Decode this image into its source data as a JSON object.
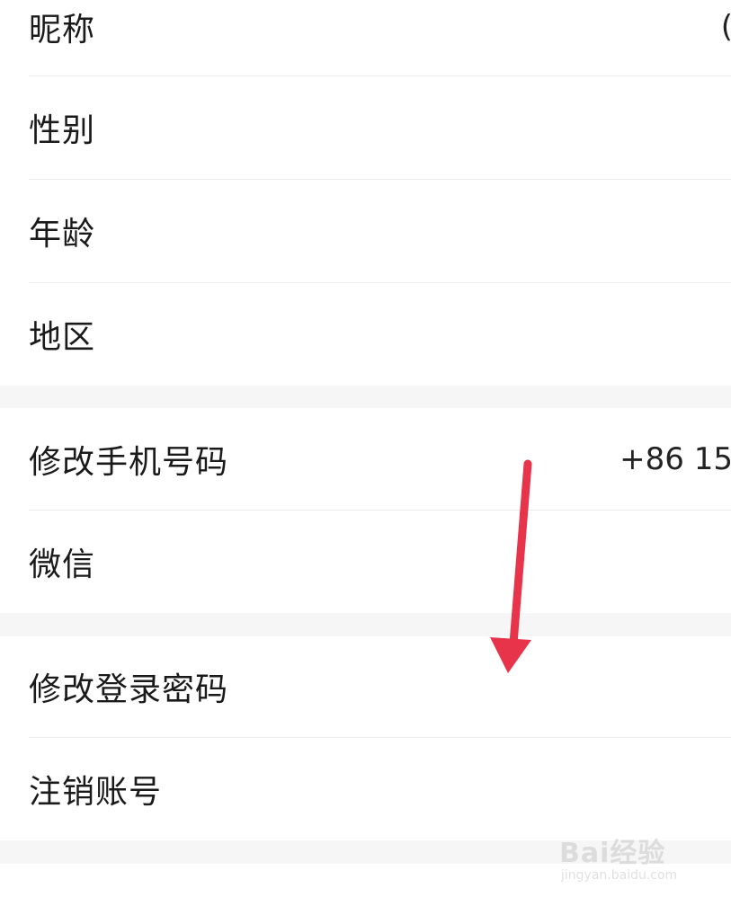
{
  "profile": {
    "nickname": {
      "label": "昵称",
      "value": "("
    },
    "gender": {
      "label": "性别"
    },
    "age": {
      "label": "年龄"
    },
    "region": {
      "label": "地区"
    }
  },
  "binding": {
    "phone": {
      "label": "修改手机号码",
      "value": "+86 15"
    },
    "wechat": {
      "label": "微信"
    }
  },
  "security": {
    "password": {
      "label": "修改登录密码"
    },
    "deactivate": {
      "label": "注销账号"
    }
  },
  "annotation": {
    "arrow_color": "#e8344a"
  },
  "watermark": {
    "brand": "Bai经验",
    "url": "jingyan.baidu.com"
  },
  "colors": {
    "background": "#ffffff",
    "section_gap": "#f6f6f6",
    "divider": "#ececec",
    "text": "#1a1a1a"
  }
}
